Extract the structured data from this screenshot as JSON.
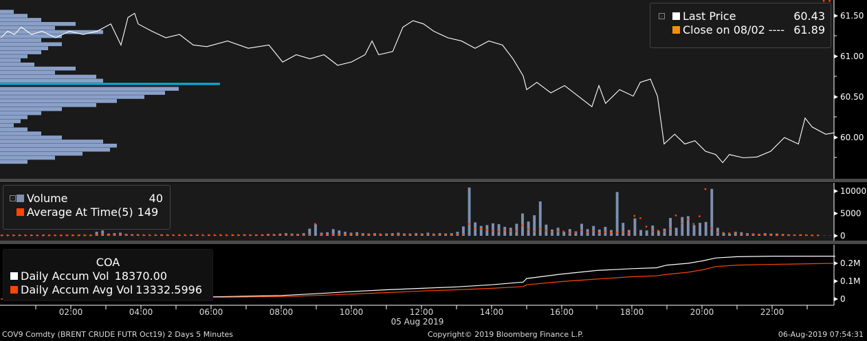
{
  "legend_price": {
    "last_label": "Last Price",
    "last_value": "60.43",
    "close_label": "Close on 08/02 ---- ",
    "close_value": "61.89",
    "last_color": "#ffffff",
    "close_color": "#f39200"
  },
  "legend_volume": {
    "vol_label": "Volume",
    "vol_value": "40",
    "avg_label": "Average At Time(5)",
    "avg_value": "149",
    "vol_color": "#7d90b3",
    "avg_color": "#ff4500"
  },
  "legend_accum": {
    "title": "COA",
    "accum_label": "Daily Accum Vol",
    "accum_value": "18370.00",
    "avg_label": "Daily Accum Avg Vol",
    "avg_value": "13332.5996"
  },
  "date_label": "05 Aug 2019",
  "footer": {
    "left": "COV9 Comdty (BRENT CRUDE FUTR  Oct19) 2 Days 5 Minutes",
    "center": "Copyright© 2019 Bloomberg Finance L.P.",
    "right": "06-Aug-2019 07:54:31"
  },
  "chart_data": [
    {
      "type": "line",
      "title": "Last Price",
      "ylim": [
        59.55,
        61.7
      ],
      "yticks": [
        "61.50",
        "61.00",
        "60.50",
        "60.00"
      ],
      "ytick_values": [
        61.5,
        61.0,
        60.5,
        60.0
      ],
      "xticks": [
        "02:00",
        "04:00",
        "06:00",
        "08:00",
        "10:00",
        "12:00",
        "14:00",
        "16:00",
        "18:00",
        "20:00",
        "22:00"
      ],
      "xtick_hours": [
        2,
        4,
        6,
        8,
        10,
        12,
        14,
        16,
        18,
        20,
        22
      ],
      "xlim": [
        0,
        23.8
      ],
      "x": [
        0,
        0.2,
        0.39,
        0.59,
        0.88,
        1.18,
        1.57,
        1.96,
        2.35,
        2.75,
        3.14,
        3.43,
        3.63,
        3.82,
        3.92,
        4.31,
        4.71,
        5.1,
        5.49,
        5.88,
        6.47,
        7.06,
        7.65,
        8.04,
        8.43,
        8.82,
        9.22,
        9.61,
        10,
        10.39,
        10.59,
        10.78,
        11.18,
        11.47,
        11.76,
        12.06,
        12.35,
        12.75,
        13.14,
        13.53,
        13.92,
        14.31,
        14.61,
        14.9,
        15,
        15.29,
        15.69,
        16.08,
        16.47,
        16.86,
        17.06,
        17.25,
        17.65,
        18.04,
        18.24,
        18.53,
        18.73,
        18.92,
        19.22,
        19.51,
        19.8,
        20.1,
        20.39,
        20.59,
        20.78,
        21.18,
        21.57,
        21.96,
        22.35,
        22.75,
        22.94,
        23.14,
        23.53,
        23.78
      ],
      "y": [
        61.23,
        61.31,
        61.27,
        61.36,
        61.27,
        61.31,
        61.23,
        61.31,
        61.27,
        61.31,
        61.4,
        61.14,
        61.48,
        61.53,
        61.4,
        61.31,
        61.23,
        61.27,
        61.14,
        61.12,
        61.19,
        61.1,
        61.14,
        60.93,
        61.02,
        60.97,
        61.02,
        60.89,
        60.93,
        61.02,
        61.19,
        61.02,
        61.06,
        61.36,
        61.44,
        61.4,
        61.31,
        61.23,
        61.19,
        61.1,
        61.19,
        61.14,
        60.97,
        60.76,
        60.59,
        60.68,
        60.55,
        60.64,
        60.51,
        60.38,
        60.64,
        60.42,
        60.59,
        60.51,
        60.68,
        60.72,
        60.51,
        59.92,
        60.04,
        59.92,
        59.96,
        59.83,
        59.79,
        59.69,
        59.79,
        59.75,
        59.76,
        59.83,
        60.0,
        59.92,
        60.24,
        60.13,
        60.04,
        60.06
      ],
      "profile_prices": [
        61.55,
        61.5,
        61.45,
        61.4,
        61.35,
        61.3,
        61.25,
        61.2,
        61.15,
        61.1,
        61.05,
        61.0,
        60.95,
        60.9,
        60.85,
        60.8,
        60.75,
        60.7,
        60.65,
        60.6,
        60.55,
        60.5,
        60.45,
        60.4,
        60.35,
        60.3,
        60.25,
        60.2,
        60.15,
        60.1,
        60.05,
        60.0,
        59.95,
        59.9,
        59.85,
        59.8,
        59.75,
        59.7
      ],
      "profile_volumes": [
        20,
        40,
        60,
        110,
        80,
        150,
        90,
        60,
        90,
        70,
        60,
        40,
        30,
        50,
        110,
        80,
        140,
        150,
        320,
        260,
        240,
        210,
        170,
        140,
        90,
        60,
        40,
        30,
        20,
        40,
        60,
        90,
        150,
        170,
        160,
        120,
        80,
        40
      ],
      "profile_peak_color": "#00b4e6"
    },
    {
      "type": "bar",
      "title": "Volume",
      "ylim": [
        0,
        11500
      ],
      "yticks": [
        "10000",
        "5000",
        "0"
      ],
      "ytick_values": [
        10000,
        5000,
        0
      ],
      "values": [
        200,
        150,
        180,
        200,
        150,
        200,
        150,
        250,
        200,
        150,
        200,
        250,
        200,
        300,
        250,
        200,
        900,
        1200,
        500,
        600,
        700,
        400,
        300,
        250,
        200,
        150,
        200,
        300,
        250,
        150,
        200,
        150,
        200,
        250,
        150,
        200,
        150,
        200,
        150,
        250,
        200,
        300,
        200,
        250,
        300,
        400,
        300,
        500,
        600,
        500,
        400,
        600,
        1600,
        2600,
        700,
        800,
        1500,
        1200,
        900,
        700,
        800,
        600,
        500,
        600,
        400,
        500,
        600,
        700,
        500,
        400,
        600,
        500,
        700,
        400,
        600,
        500,
        600,
        900,
        2100,
        10800,
        3000,
        2200,
        2400,
        2800,
        2600,
        2000,
        1800,
        2700,
        5000,
        3200,
        4600,
        7700,
        2500,
        1400,
        1800,
        900,
        1500,
        1000,
        2700,
        1500,
        2200,
        1400,
        2000,
        1300,
        9800,
        2900,
        1300,
        3900,
        1300,
        1200,
        2300,
        1100,
        1600,
        4000,
        1800,
        4200,
        4400,
        2400,
        2900,
        3100,
        10500,
        1800,
        700,
        500,
        900,
        800,
        600,
        500,
        400,
        600,
        500,
        500,
        400,
        300,
        200,
        300,
        200,
        150,
        100,
        50,
        40
      ],
      "avg": [
        150,
        150,
        150,
        150,
        150,
        150,
        150,
        150,
        150,
        150,
        150,
        150,
        150,
        150,
        150,
        150,
        300,
        400,
        300,
        300,
        300,
        300,
        250,
        250,
        200,
        200,
        200,
        200,
        200,
        200,
        200,
        200,
        200,
        200,
        200,
        200,
        200,
        200,
        200,
        200,
        200,
        200,
        200,
        200,
        200,
        300,
        300,
        300,
        300,
        300,
        300,
        300,
        300,
        2700,
        400,
        400,
        400,
        400,
        400,
        400,
        400,
        400,
        400,
        400,
        400,
        400,
        400,
        400,
        400,
        400,
        400,
        400,
        400,
        400,
        400,
        400,
        400,
        400,
        400,
        2700,
        1700,
        1600,
        1400,
        1100,
        1000,
        1300,
        1100,
        1100,
        2400,
        1500,
        1000,
        1600,
        1200,
        900,
        1000,
        1000,
        700,
        700,
        1300,
        800,
        1100,
        700,
        800,
        700,
        700,
        900,
        700,
        4500,
        4000,
        2100,
        1100,
        1200,
        1000,
        1600,
        4600,
        2800,
        3700,
        2700,
        4400,
        10500,
        1700,
        800,
        700,
        600,
        600,
        500,
        400,
        400,
        300,
        300,
        300,
        200,
        200,
        200,
        200,
        200,
        200,
        150,
        150
      ]
    },
    {
      "type": "line",
      "title": "COA",
      "ylim": [
        -20000,
        290000
      ],
      "yticks": [
        "0.2M",
        "0.1M",
        "0"
      ],
      "ytick_values": [
        200000,
        100000,
        0
      ],
      "x": [
        0,
        3,
        6,
        8,
        9,
        10,
        11,
        12,
        13,
        14,
        14.9,
        15,
        16,
        17,
        18,
        18.7,
        19,
        19.6,
        20,
        20.4,
        21,
        22,
        23.8
      ],
      "series": [
        {
          "name": "Daily Accum Vol",
          "color": "#ffffff",
          "values": [
            0,
            5000,
            12000,
            20000,
            30000,
            42000,
            52000,
            60000,
            68000,
            80000,
            95000,
            115000,
            140000,
            160000,
            170000,
            175000,
            190000,
            200000,
            213000,
            230000,
            237000,
            240000,
            240000
          ]
        },
        {
          "name": "Daily Accum Avg Vol",
          "color": "#ff4500",
          "values": [
            0,
            4000,
            9000,
            14000,
            20000,
            28000,
            36000,
            45000,
            52000,
            60000,
            70000,
            80000,
            98000,
            112000,
            125000,
            130000,
            138000,
            150000,
            163000,
            182000,
            190000,
            194000,
            200000
          ]
        }
      ]
    }
  ]
}
